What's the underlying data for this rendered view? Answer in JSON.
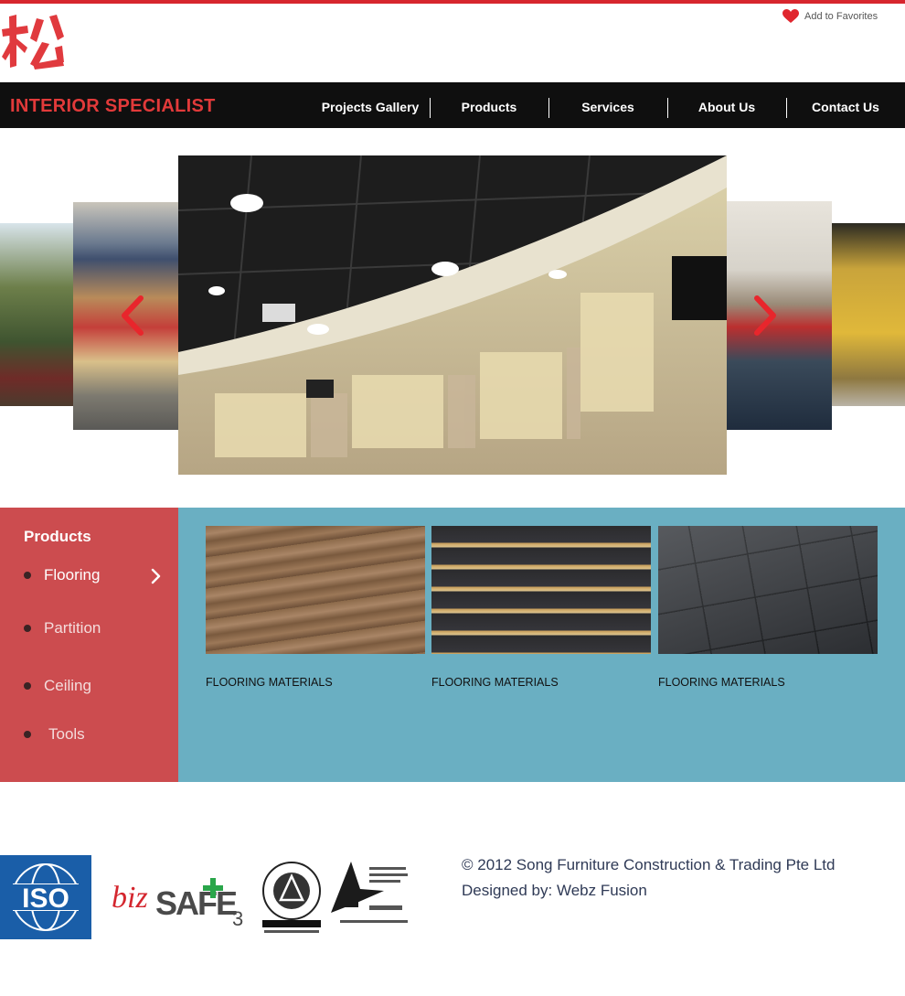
{
  "colors": {
    "brand_red": "#d7262e",
    "nav_bg": "#0f0f0f",
    "sidebar_red": "#cc4c4f",
    "content_blue": "#6aafc2"
  },
  "header": {
    "favorites_label": "Add to Favorites",
    "favorites_icon": "heart-icon",
    "tagline": "INTERIOR SPECIALIST"
  },
  "nav": {
    "items": [
      "Projects Gallery",
      "Products",
      "Services",
      "About Us",
      "Contact Us"
    ]
  },
  "carousel": {
    "prev_icon": "chevron-left-icon",
    "next_icon": "chevron-right-icon"
  },
  "products": {
    "title": "Products",
    "menu": [
      {
        "label": "Flooring",
        "active": true
      },
      {
        "label": "Partition",
        "active": false
      },
      {
        "label": "Ceiling",
        "active": false
      },
      {
        "label": "Tools",
        "active": false
      }
    ],
    "cards": [
      {
        "caption": "FLOORING MATERIALS"
      },
      {
        "caption": "FLOORING MATERIALS"
      },
      {
        "caption": "FLOORING MATERIALS"
      }
    ]
  },
  "footer": {
    "certs": {
      "iso": "ISO",
      "bizsafe_a": "biz",
      "bizsafe_b": "SAFE",
      "bizsafe_c": "3"
    },
    "copyright": "© 2012 Song Furniture Construction & Trading Pte Ltd",
    "designed_by": "Designed by: Webz Fusion"
  }
}
